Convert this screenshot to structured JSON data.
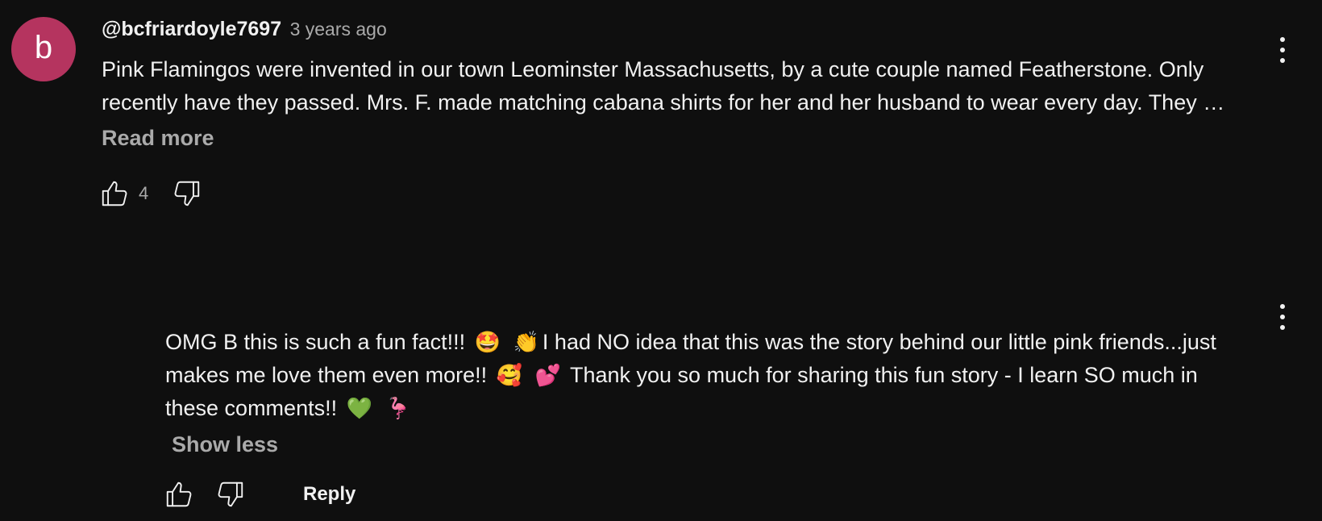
{
  "comment": {
    "avatar_letter": "b",
    "avatar_color": "#b5345f",
    "author": "@bcfriardoyle7697",
    "timestamp": "3 years ago",
    "text_line_1": "Pink Flamingos were invented in our town Leominster Massachusetts, by a cute couple named Featherstone. Only",
    "text_line_2": "recently have they passed. Mrs. F. made matching cabana shirts for her and her husband to wear every day. They …",
    "read_more": "Read more",
    "like_count": "4",
    "icons": {
      "like": "thumbs-up-icon",
      "dislike": "thumbs-down-icon",
      "menu": "more-vertical-icon"
    }
  },
  "reply": {
    "text_line_1_a": "OMG B this is such a fun fact!!!",
    "text_line_1_b": "I had NO idea that this was the story behind our little pink friends...just",
    "text_line_2_a": "makes me love them even more!!",
    "text_line_2_b": "Thank you so much for sharing this fun story - I learn SO much in",
    "text_line_3_a": "these comments!!",
    "emojis": {
      "star_struck": "🤩",
      "clapping": "👏",
      "smiling_hearts": "🥰",
      "two_hearts": "💕",
      "green_heart": "💚",
      "flamingo": "🦩"
    },
    "show_less": "Show less",
    "reply_label": "Reply",
    "icons": {
      "like": "thumbs-up-icon",
      "dislike": "thumbs-down-icon",
      "menu": "more-vertical-icon"
    }
  },
  "colors": {
    "background": "#0f0f0f",
    "primary_text": "#f1f1f1",
    "secondary_text": "#aaaaaa"
  }
}
